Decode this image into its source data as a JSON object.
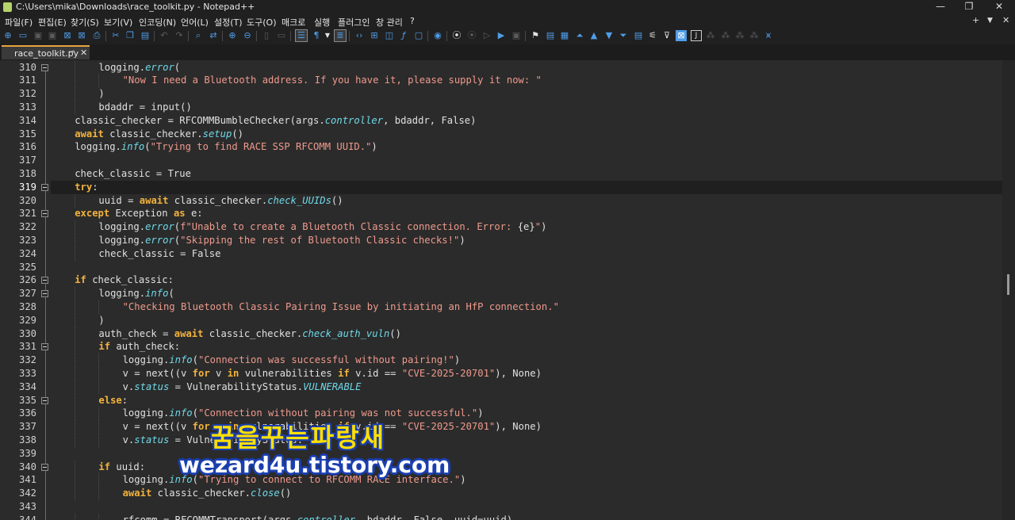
{
  "window": {
    "title": "C:\\Users\\mika\\Downloads\\race_toolkit.py - Notepad++",
    "minimize": "—",
    "maximize": "❐",
    "close": "✕"
  },
  "menu": {
    "items": [
      "파일(F)",
      "편집(E)",
      "찾기(S)",
      "보기(V)",
      "인코딩(N)",
      "언어(L)",
      "설정(T)",
      "도구(O)",
      "매크로",
      "실행",
      "플러그인",
      "창 관리",
      "?"
    ],
    "right_plus": "+",
    "right_down": "▼",
    "right_close": "✕"
  },
  "toolbar": {
    "icons": [
      "new-file-icon",
      "open-file-icon",
      "save-icon",
      "save-all-icon",
      "close-icon",
      "close-all-icon",
      "print-icon",
      "cut-icon",
      "copy-icon",
      "paste-icon",
      "undo-icon",
      "redo-icon",
      "find-icon",
      "replace-icon",
      "zoom-in-icon",
      "zoom-out-icon",
      "sync-vertical-icon",
      "sync-horizontal-icon",
      "word-wrap-icon",
      "show-all-chars-icon",
      "indent-guide-icon",
      "udl-icon",
      "doc-map-icon",
      "function-list-icon",
      "folder-workspace-icon",
      "monitoring-icon",
      "record-macro-icon",
      "stop-macro-icon",
      "play-macro-icon",
      "run-macro-multiple-icon",
      "save-macro-icon"
    ]
  },
  "tab": {
    "label": "race_toolkit.py",
    "pin": "📌",
    "close": "✕"
  },
  "editor": {
    "current_line": 319,
    "fold_markers": [
      310,
      319,
      321,
      326,
      327,
      331,
      335,
      340
    ],
    "lines": [
      {
        "n": "310",
        "indent": 2,
        "tokens": [
          [
            "t",
            "logging."
          ],
          [
            "f",
            "error"
          ],
          [
            "t",
            "("
          ]
        ]
      },
      {
        "n": "311",
        "indent": 3,
        "tokens": [
          [
            "s",
            "\"Now I need a Bluetooth address. If you have it, please supply it now: \""
          ]
        ]
      },
      {
        "n": "312",
        "indent": 2,
        "tokens": [
          [
            "t",
            ")"
          ]
        ]
      },
      {
        "n": "313",
        "indent": 2,
        "tokens": [
          [
            "t",
            "bdaddr = input()"
          ]
        ]
      },
      {
        "n": "314",
        "indent": 1,
        "tokens": [
          [
            "t",
            "classic_checker = RFCOMMBumbleChecker(args."
          ],
          [
            "f",
            "controller"
          ],
          [
            "t",
            ", bdaddr, False)"
          ]
        ]
      },
      {
        "n": "315",
        "indent": 1,
        "tokens": [
          [
            "k",
            "await"
          ],
          [
            "t",
            " classic_checker."
          ],
          [
            "f",
            "setup"
          ],
          [
            "t",
            "()"
          ]
        ]
      },
      {
        "n": "316",
        "indent": 1,
        "tokens": [
          [
            "t",
            "logging."
          ],
          [
            "f",
            "info"
          ],
          [
            "t",
            "("
          ],
          [
            "s",
            "\"Trying to find RACE SSP RFCOMM UUID.\""
          ],
          [
            "t",
            ")"
          ]
        ]
      },
      {
        "n": "317",
        "indent": 0,
        "tokens": []
      },
      {
        "n": "318",
        "indent": 1,
        "tokens": [
          [
            "t",
            "check_classic = True"
          ]
        ]
      },
      {
        "n": "319",
        "indent": 1,
        "tokens": [
          [
            "k",
            "try"
          ],
          [
            "t",
            ":"
          ]
        ]
      },
      {
        "n": "320",
        "indent": 2,
        "tokens": [
          [
            "t",
            "uuid = "
          ],
          [
            "k",
            "await"
          ],
          [
            "t",
            " classic_checker."
          ],
          [
            "f",
            "check_UUIDs"
          ],
          [
            "t",
            "()"
          ]
        ]
      },
      {
        "n": "321",
        "indent": 1,
        "tokens": [
          [
            "k",
            "except"
          ],
          [
            "t",
            " Exception "
          ],
          [
            "k",
            "as"
          ],
          [
            "t",
            " e:"
          ]
        ]
      },
      {
        "n": "322",
        "indent": 2,
        "tokens": [
          [
            "t",
            "logging."
          ],
          [
            "f",
            "error"
          ],
          [
            "t",
            "("
          ],
          [
            "s",
            "f\"Unable to create a Bluetooth Classic connection. Error: "
          ],
          [
            "t",
            "{e}"
          ],
          [
            "s",
            "\""
          ],
          [
            "t",
            ")"
          ]
        ]
      },
      {
        "n": "323",
        "indent": 2,
        "tokens": [
          [
            "t",
            "logging."
          ],
          [
            "f",
            "error"
          ],
          [
            "t",
            "("
          ],
          [
            "s",
            "\"Skipping the rest of Bluetooth Classic checks!\""
          ],
          [
            "t",
            ")"
          ]
        ]
      },
      {
        "n": "324",
        "indent": 2,
        "tokens": [
          [
            "t",
            "check_classic = False"
          ]
        ]
      },
      {
        "n": "325",
        "indent": 0,
        "tokens": []
      },
      {
        "n": "326",
        "indent": 1,
        "tokens": [
          [
            "k",
            "if"
          ],
          [
            "t",
            " check_classic:"
          ]
        ]
      },
      {
        "n": "327",
        "indent": 2,
        "tokens": [
          [
            "t",
            "logging."
          ],
          [
            "f",
            "info"
          ],
          [
            "t",
            "("
          ]
        ]
      },
      {
        "n": "328",
        "indent": 3,
        "tokens": [
          [
            "s",
            "\"Checking Bluetooth Classic Pairing Issue by initiating an HfP connection.\""
          ]
        ]
      },
      {
        "n": "329",
        "indent": 2,
        "tokens": [
          [
            "t",
            ")"
          ]
        ]
      },
      {
        "n": "330",
        "indent": 2,
        "tokens": [
          [
            "t",
            "auth_check = "
          ],
          [
            "k",
            "await"
          ],
          [
            "t",
            " classic_checker."
          ],
          [
            "f",
            "check_auth_vuln"
          ],
          [
            "t",
            "()"
          ]
        ]
      },
      {
        "n": "331",
        "indent": 2,
        "tokens": [
          [
            "k",
            "if"
          ],
          [
            "t",
            " auth_check:"
          ]
        ]
      },
      {
        "n": "332",
        "indent": 3,
        "tokens": [
          [
            "t",
            "logging."
          ],
          [
            "f",
            "info"
          ],
          [
            "t",
            "("
          ],
          [
            "s",
            "\"Connection was successful without pairing!\""
          ],
          [
            "t",
            ")"
          ]
        ]
      },
      {
        "n": "333",
        "indent": 3,
        "tokens": [
          [
            "t",
            "v = next((v "
          ],
          [
            "k",
            "for"
          ],
          [
            "t",
            " v "
          ],
          [
            "k",
            "in"
          ],
          [
            "t",
            " vulnerabilities "
          ],
          [
            "k",
            "if"
          ],
          [
            "t",
            " v.id == "
          ],
          [
            "s",
            "\"CVE-2025-20701\""
          ],
          [
            "t",
            "), None)"
          ]
        ]
      },
      {
        "n": "334",
        "indent": 3,
        "tokens": [
          [
            "t",
            "v."
          ],
          [
            "f",
            "status"
          ],
          [
            "t",
            " = VulnerabilityStatus."
          ],
          [
            "f",
            "VULNERABLE"
          ]
        ]
      },
      {
        "n": "335",
        "indent": 2,
        "tokens": [
          [
            "k",
            "else"
          ],
          [
            "t",
            ":"
          ]
        ]
      },
      {
        "n": "336",
        "indent": 3,
        "tokens": [
          [
            "t",
            "logging."
          ],
          [
            "f",
            "info"
          ],
          [
            "t",
            "("
          ],
          [
            "s",
            "\"Connection without pairing was not successful.\""
          ],
          [
            "t",
            ")"
          ]
        ]
      },
      {
        "n": "337",
        "indent": 3,
        "tokens": [
          [
            "t",
            "v = next((v "
          ],
          [
            "k",
            "for"
          ],
          [
            "t",
            " v "
          ],
          [
            "k",
            "in"
          ],
          [
            "t",
            " vulnerabilities "
          ],
          [
            "k",
            "if"
          ],
          [
            "t",
            " v.id == "
          ],
          [
            "s",
            "\"CVE-2025-20701\""
          ],
          [
            "t",
            "), None)"
          ]
        ]
      },
      {
        "n": "338",
        "indent": 3,
        "tokens": [
          [
            "t",
            "v."
          ],
          [
            "f",
            "status"
          ],
          [
            "t",
            " = VulnerabilityStatus."
          ]
        ]
      },
      {
        "n": "339",
        "indent": 0,
        "tokens": []
      },
      {
        "n": "340",
        "indent": 2,
        "tokens": [
          [
            "k",
            "if"
          ],
          [
            "t",
            " uuid:"
          ]
        ]
      },
      {
        "n": "341",
        "indent": 3,
        "tokens": [
          [
            "t",
            "logging."
          ],
          [
            "f",
            "info"
          ],
          [
            "t",
            "("
          ],
          [
            "s",
            "\"Trying to connect to RFCOMM RACE interface.\""
          ],
          [
            "t",
            ")"
          ]
        ]
      },
      {
        "n": "342",
        "indent": 3,
        "tokens": [
          [
            "k",
            "await"
          ],
          [
            "t",
            " classic_checker."
          ],
          [
            "f",
            "close"
          ],
          [
            "t",
            "()"
          ]
        ]
      },
      {
        "n": "343",
        "indent": 0,
        "tokens": []
      },
      {
        "n": "344",
        "indent": 3,
        "tokens": [
          [
            "t",
            "rfcomm = RFCOMMTransport(args."
          ],
          [
            "f",
            "controller"
          ],
          [
            "t",
            ", bdaddr, False, uuid=uuid)"
          ]
        ]
      }
    ]
  },
  "watermark": {
    "line1": "꿈을꾸는파랑새",
    "line2": "wezard4u.tistory.com"
  }
}
